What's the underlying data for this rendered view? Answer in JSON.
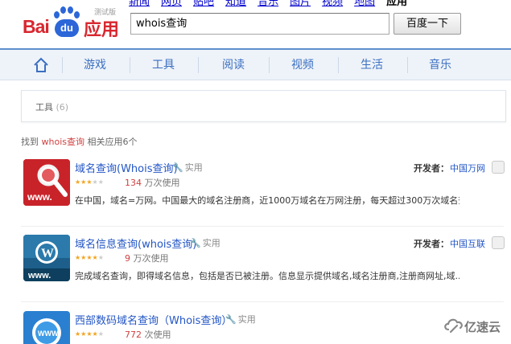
{
  "header": {
    "logo_bai": "Bai",
    "logo_du": "du",
    "logo_app": "应用",
    "logo_version": "测试版",
    "topnav": [
      "新闻",
      "网页",
      "贴吧",
      "知道",
      "音乐",
      "图片",
      "视频",
      "地图",
      "应用"
    ],
    "topnav_active_index": 8,
    "search_value": "whois查询",
    "search_button": "百度一下"
  },
  "nav": {
    "items": [
      "游戏",
      "工具",
      "阅读",
      "视频",
      "生活",
      "音乐"
    ]
  },
  "toolbox": {
    "label": "工具",
    "count": "(6)"
  },
  "found": {
    "prefix": "找到",
    "keyword": "whois查询",
    "suffix": "相关应用6个"
  },
  "results": [
    {
      "title": "域名查询(Whois查询)",
      "tag": "实用",
      "rating": 3,
      "uses_number": "134",
      "uses_unit": "万次使用",
      "description": "在中国，域名=万网。中国最大的域名注册商，近1000万域名在万网注册，每天超过300万次域名查...",
      "developer_label": "开发者：",
      "developer": "中国万网",
      "icon": "magnifier-www-icon",
      "color": "#c9232a"
    },
    {
      "title": "域名信息查询(whois查询)",
      "tag": "实用",
      "rating": 4,
      "uses_number": "9",
      "uses_unit": "万次使用",
      "description": "完成域名查询，即得域名信息，包括是否已被注册。信息显示提供域名,域名注册商,注册商网址,域...",
      "developer_label": "开发者：",
      "developer": "中国互联",
      "icon": "wordpress-www-icon",
      "color": "#1d5f8a"
    },
    {
      "title": "西部数码域名查询（Whois查询）",
      "tag": "实用",
      "rating": 4,
      "uses_number": "772",
      "uses_unit": "次使用",
      "description": "",
      "developer_label": "",
      "developer": "",
      "icon": "globe-www-icon",
      "color": "#2a7fd0"
    }
  ],
  "watermark": "亿速云"
}
